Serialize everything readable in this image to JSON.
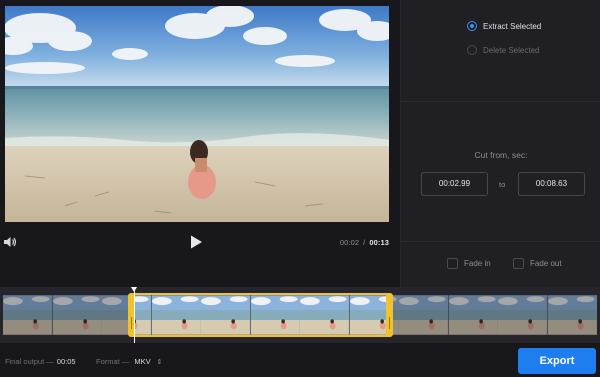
{
  "mode": {
    "options": [
      {
        "label": "Extract Selected",
        "selected": true
      },
      {
        "label": "Delete Selected",
        "selected": false
      }
    ]
  },
  "cut": {
    "title": "Cut from, sec:",
    "from": "00:02.99",
    "to_label": "to",
    "to": "00:08.63"
  },
  "fade": {
    "in_label": "Fade in",
    "out_label": "Fade out",
    "in_checked": false,
    "out_checked": false
  },
  "player": {
    "current_time": "00:02",
    "separator": "/",
    "total_time": "00:13"
  },
  "footer": {
    "final_label": "Final output —",
    "final_value": "00:05",
    "format_label": "Format —",
    "format_value": "MKV"
  },
  "export_label": "Export",
  "colors": {
    "accent": "#1e7ef0",
    "selection": "#f2c22e",
    "background": "#18181c",
    "panel": "#1f1f24"
  },
  "icons": {
    "volume": "speaker-icon",
    "play": "play-icon",
    "format_chevron": "chevron-updown-icon"
  }
}
